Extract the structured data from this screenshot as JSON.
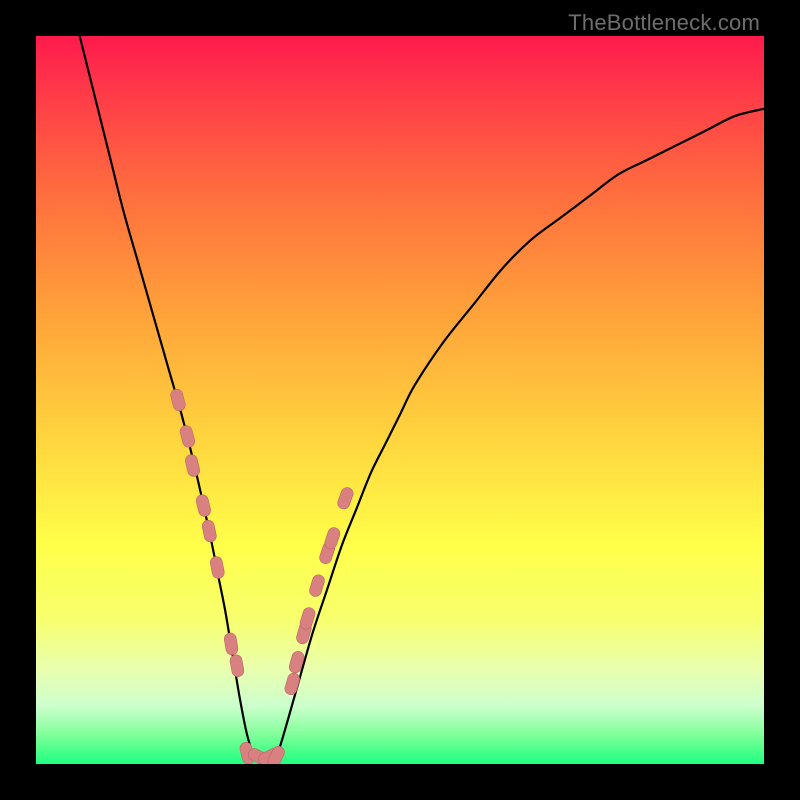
{
  "watermark": "TheBottleneck.com",
  "colors": {
    "background": "#000000",
    "curve": "#000000",
    "marker_fill": "#d98080",
    "marker_stroke": "#b86666"
  },
  "chart_data": {
    "type": "line",
    "title": "",
    "xlabel": "",
    "ylabel": "",
    "xlim": [
      0,
      100
    ],
    "ylim": [
      0,
      100
    ],
    "x": [
      6,
      8,
      10,
      12,
      14,
      16,
      18,
      20,
      22,
      24,
      25,
      26,
      27,
      28,
      29,
      30,
      31,
      32,
      33,
      34,
      36,
      38,
      40,
      42,
      44,
      46,
      48,
      50,
      52,
      56,
      60,
      64,
      68,
      72,
      76,
      80,
      84,
      88,
      92,
      96,
      100
    ],
    "values": [
      100,
      92,
      84,
      76,
      69,
      62,
      55,
      48,
      40,
      31,
      26,
      21,
      15,
      9,
      4,
      1,
      0,
      0,
      1,
      4,
      11,
      18,
      24,
      30,
      35,
      40,
      44,
      48,
      52,
      58,
      63,
      68,
      72,
      75,
      78,
      81,
      83,
      85,
      87,
      89,
      90
    ],
    "markers_x": [
      19.5,
      20.8,
      21.5,
      23.0,
      23.8,
      24.9,
      26.8,
      27.6,
      29.0,
      30.6,
      32.0,
      33.0,
      35.2,
      35.8,
      36.8,
      37.3,
      38.6,
      40.0,
      40.7,
      42.5
    ],
    "markers_y": [
      50.0,
      45.0,
      41.0,
      35.5,
      32.0,
      27.0,
      16.5,
      13.5,
      1.5,
      1.0,
      1.0,
      1.0,
      11.0,
      14.0,
      18.0,
      20.0,
      24.5,
      29.0,
      31.0,
      36.5
    ]
  }
}
